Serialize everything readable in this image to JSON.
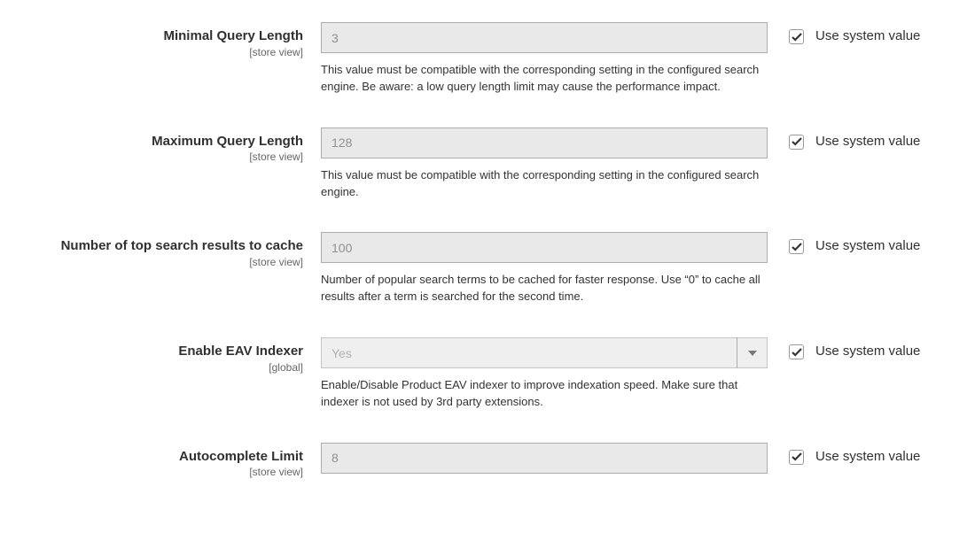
{
  "checkbox_label": "Use system value",
  "fields": {
    "min_query_length": {
      "label": "Minimal Query Length",
      "scope": "[store view]",
      "value": "3",
      "help": "This value must be compatible with the corresponding setting in the configured search engine. Be aware: a low query length limit may cause the performance impact.",
      "use_system": true
    },
    "max_query_length": {
      "label": "Maximum Query Length",
      "scope": "[store view]",
      "value": "128",
      "help": "This value must be compatible with the corresponding setting in the configured search engine.",
      "use_system": true
    },
    "top_results_cache": {
      "label": "Number of top search results to cache",
      "scope": "[store view]",
      "value": "100",
      "help": "Number of popular search terms to be cached for faster response. Use “0” to cache all results after a term is searched for the second time.",
      "use_system": true
    },
    "enable_eav_indexer": {
      "label": "Enable EAV Indexer",
      "scope": "[global]",
      "value": "Yes",
      "help": "Enable/Disable Product EAV indexer to improve indexation speed. Make sure that indexer is not used by 3rd party extensions.",
      "use_system": true
    },
    "autocomplete_limit": {
      "label": "Autocomplete Limit",
      "scope": "[store view]",
      "value": "8",
      "use_system": true
    }
  }
}
